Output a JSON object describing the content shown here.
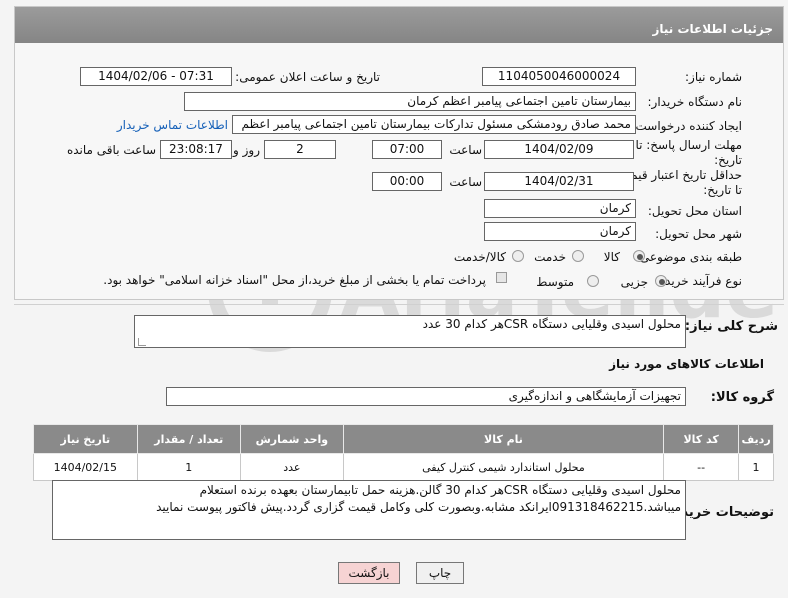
{
  "header": {
    "title": "جزئیات اطلاعات نیاز"
  },
  "need_number": {
    "label": "شماره نیاز:",
    "value": "1104050046000024"
  },
  "announce": {
    "label": "تاریخ و ساعت اعلان عمومی:",
    "value": "1404/02/06 - 07:31"
  },
  "buyer_org": {
    "label": "نام دستگاه خریدار:",
    "value": "بیمارستان تامین اجتماعی پیامبر اعظم کرمان"
  },
  "requester": {
    "label": "ایجاد کننده درخواست:",
    "value": "محمد صادق  رودمشکی مسئول تدارکات بیمارستان تامین اجتماعی پیامبر اعظم",
    "contact_link": "اطلاعات تماس خریدار"
  },
  "reply_deadline": {
    "label": "مهلت ارسال پاسخ: تا تاریخ:",
    "date": "1404/02/09",
    "time_label": "ساعت",
    "time": "07:00",
    "days": "2",
    "days_label": "روز و",
    "remaining_time": "23:08:17",
    "remaining_label": "ساعت باقی مانده"
  },
  "price_validity": {
    "label": "حداقل تاریخ اعتبار قیمت: تا تاریخ:",
    "date": "1404/02/31",
    "time_label": "ساعت",
    "time": "00:00"
  },
  "delivery_province": {
    "label": "استان محل تحویل:",
    "value": "کرمان"
  },
  "delivery_city": {
    "label": "شهر محل تحویل:",
    "value": "کرمان"
  },
  "category": {
    "label": "طبقه بندی موضوعی:",
    "options": [
      "کالا",
      "خدمت",
      "کالا/خدمت"
    ],
    "selected": "کالا"
  },
  "purchase_process": {
    "label": "نوع فرآیند خرید :",
    "options": [
      "جزیی",
      "متوسط"
    ],
    "selected": "جزیی",
    "note": "پرداخت تمام یا بخشی از مبلغ خرید،از محل \"اسناد خزانه اسلامی\" خواهد بود."
  },
  "overview": {
    "label": "شرح کلی نیاز:",
    "value": "محلول اسیدی وقلیایی دستگاه CSRهر کدام 30 عدد"
  },
  "goods_info": {
    "title": "اطلاعات کالاهای مورد نیاز"
  },
  "goods_group": {
    "label": "گروه کالا:",
    "value": "تجهیزات آزمایشگاهی و اندازه‌گیری"
  },
  "goods_table": {
    "columns": [
      "ردیف",
      "کد کالا",
      "نام کالا",
      "واحد شمارش",
      "تعداد / مقدار",
      "تاریخ نیاز"
    ],
    "rows": [
      [
        "1",
        "--",
        "محلول استاندارد شیمی کنترل کیفی",
        "عدد",
        "1",
        "1404/02/15"
      ]
    ]
  },
  "buyer_notes": {
    "label": "توضیحات خریدار:",
    "line1": "محلول اسیدی وقلیایی دستگاه CSRهر کدام 30 گالن.هزینه حمل تابیمارستان بعهده برنده استعلام",
    "line2": "میباشد.09131846221‌5ایرانکد مشابه.وبصورت کلی وکامل قیمت گزاری گردد.پیش فاکتور پیوست نمایید"
  },
  "buttons": {
    "print": "چاپ",
    "back": "بازگشت"
  },
  "watermark": {
    "text": "AriaTender.neT"
  }
}
